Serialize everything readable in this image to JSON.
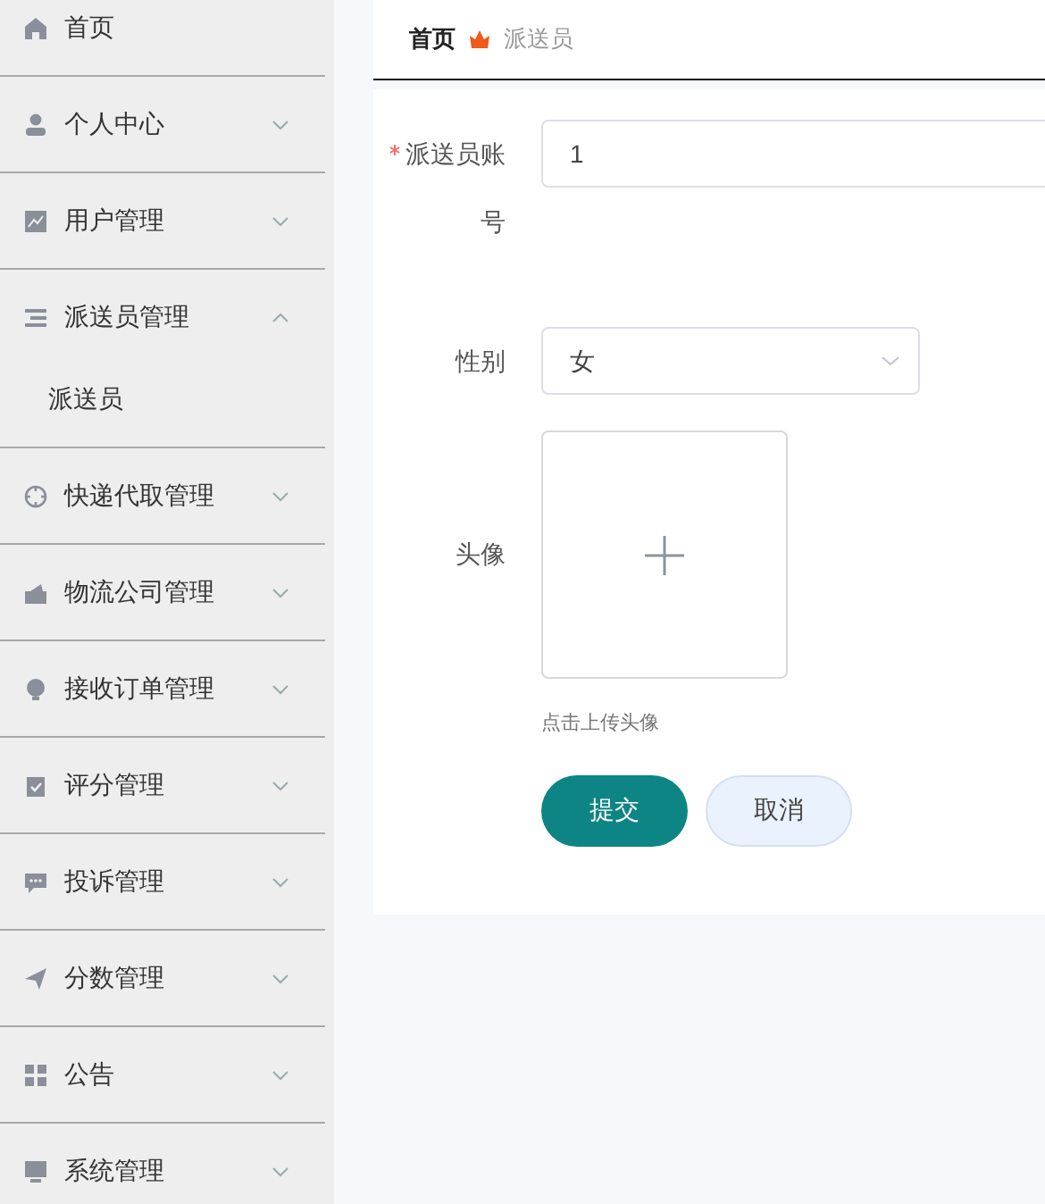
{
  "sidebar": {
    "items": [
      {
        "kind": "link",
        "label": "首页"
      },
      {
        "kind": "menu",
        "label": "个人中心",
        "expanded": false
      },
      {
        "kind": "menu",
        "label": "用户管理",
        "expanded": false
      },
      {
        "kind": "menu",
        "label": "派送员管理",
        "expanded": true,
        "children": [
          {
            "label": "派送员"
          }
        ]
      },
      {
        "kind": "menu",
        "label": "快递代取管理",
        "expanded": false
      },
      {
        "kind": "menu",
        "label": "物流公司管理",
        "expanded": false
      },
      {
        "kind": "menu",
        "label": "接收订单管理",
        "expanded": false
      },
      {
        "kind": "menu",
        "label": "评分管理",
        "expanded": false
      },
      {
        "kind": "menu",
        "label": "投诉管理",
        "expanded": false
      },
      {
        "kind": "menu",
        "label": "分数管理",
        "expanded": false
      },
      {
        "kind": "menu",
        "label": "公告",
        "expanded": false
      },
      {
        "kind": "menu",
        "label": "系统管理",
        "expanded": false
      }
    ]
  },
  "breadcrumb": [
    "首页",
    "派送员"
  ],
  "form": {
    "fields": [
      {
        "kind": "text",
        "label": "派送员账号",
        "required": true,
        "value": "1"
      },
      {
        "kind": "select",
        "label": "性别",
        "required": false,
        "value": "女"
      },
      {
        "kind": "upload",
        "label": "头像",
        "required": false,
        "hint": "点击上传头像"
      }
    ],
    "buttons": [
      {
        "kind": "primary",
        "label": "提交"
      },
      {
        "kind": "secondary",
        "label": "取消"
      }
    ]
  }
}
